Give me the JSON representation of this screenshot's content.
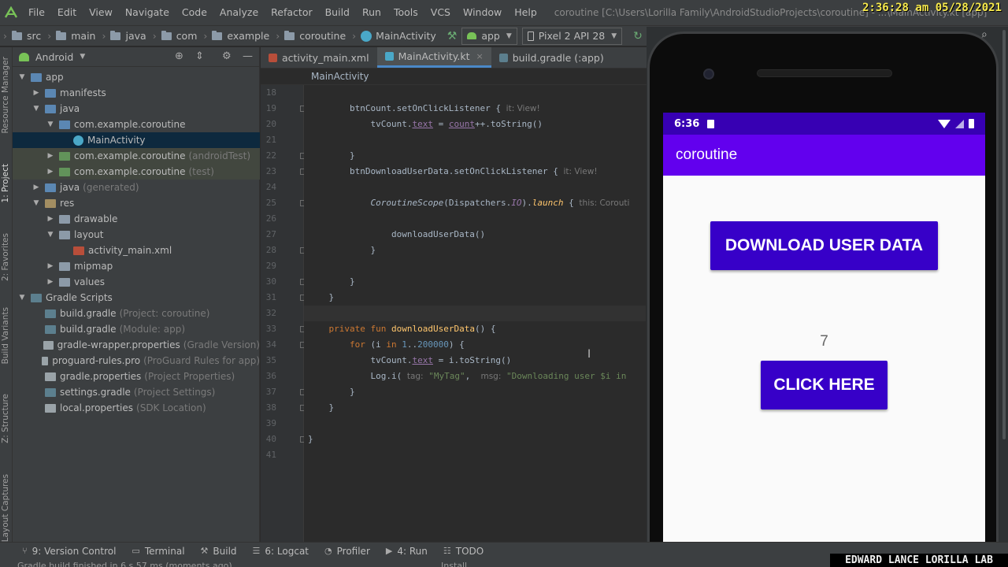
{
  "clock": "2:36:28 am 05/28/2021",
  "menu": [
    "File",
    "Edit",
    "View",
    "Navigate",
    "Code",
    "Analyze",
    "Refactor",
    "Build",
    "Run",
    "Tools",
    "VCS",
    "Window",
    "Help"
  ],
  "window_title": "coroutine [C:\\Users\\Lorilla Family\\AndroidStudioProjects\\coroutine] - ...\\MainActivity.kt [app]",
  "breadcrumb": [
    "src",
    "main",
    "java",
    "com",
    "example",
    "coroutine",
    "MainActivity"
  ],
  "run_config": "app",
  "device": "Pixel 2 API 28",
  "project_view": "Android",
  "left_strip": [
    "Resource Manager",
    "1: Project",
    "2: Favorites",
    "Build Variants",
    "Z: Structure",
    "Layout Captures"
  ],
  "tree": [
    {
      "label": "app",
      "hint": "",
      "depth": 0,
      "arrow": "▼",
      "icon": "i-folder-blue",
      "state": ""
    },
    {
      "label": "manifests",
      "hint": "",
      "depth": 1,
      "arrow": "▶",
      "icon": "i-folder-blue",
      "state": ""
    },
    {
      "label": "java",
      "hint": "",
      "depth": 1,
      "arrow": "▼",
      "icon": "i-folder-blue",
      "state": ""
    },
    {
      "label": "com.example.coroutine",
      "hint": "",
      "depth": 2,
      "arrow": "▼",
      "icon": "i-folder-blue",
      "state": ""
    },
    {
      "label": "MainActivity",
      "hint": "",
      "depth": 3,
      "arrow": "",
      "icon": "i-kt",
      "state": "sel"
    },
    {
      "label": "com.example.coroutine",
      "hint": "(androidTest)",
      "depth": 2,
      "arrow": "▶",
      "icon": "i-folder-green",
      "state": "test"
    },
    {
      "label": "com.example.coroutine",
      "hint": "(test)",
      "depth": 2,
      "arrow": "▶",
      "icon": "i-folder-green",
      "state": "test"
    },
    {
      "label": "java",
      "hint": "(generated)",
      "depth": 1,
      "arrow": "▶",
      "icon": "i-folder-blue",
      "state": ""
    },
    {
      "label": "res",
      "hint": "",
      "depth": 1,
      "arrow": "▼",
      "icon": "i-folder-res",
      "state": ""
    },
    {
      "label": "drawable",
      "hint": "",
      "depth": 2,
      "arrow": "▶",
      "icon": "i-folder",
      "state": ""
    },
    {
      "label": "layout",
      "hint": "",
      "depth": 2,
      "arrow": "▼",
      "icon": "i-folder",
      "state": ""
    },
    {
      "label": "activity_main.xml",
      "hint": "",
      "depth": 3,
      "arrow": "",
      "icon": "i-xml",
      "state": ""
    },
    {
      "label": "mipmap",
      "hint": "",
      "depth": 2,
      "arrow": "▶",
      "icon": "i-folder",
      "state": ""
    },
    {
      "label": "values",
      "hint": "",
      "depth": 2,
      "arrow": "▶",
      "icon": "i-folder",
      "state": ""
    },
    {
      "label": "Gradle Scripts",
      "hint": "",
      "depth": 0,
      "arrow": "▼",
      "icon": "i-gradle",
      "state": ""
    },
    {
      "label": "build.gradle",
      "hint": "(Project: coroutine)",
      "depth": 1,
      "arrow": "",
      "icon": "i-gradle",
      "state": ""
    },
    {
      "label": "build.gradle",
      "hint": "(Module: app)",
      "depth": 1,
      "arrow": "",
      "icon": "i-gradle",
      "state": ""
    },
    {
      "label": "gradle-wrapper.properties",
      "hint": "(Gradle Version)",
      "depth": 1,
      "arrow": "",
      "icon": "i-file",
      "state": ""
    },
    {
      "label": "proguard-rules.pro",
      "hint": "(ProGuard Rules for app)",
      "depth": 1,
      "arrow": "",
      "icon": "i-file",
      "state": ""
    },
    {
      "label": "gradle.properties",
      "hint": "(Project Properties)",
      "depth": 1,
      "arrow": "",
      "icon": "i-file",
      "state": ""
    },
    {
      "label": "settings.gradle",
      "hint": "(Project Settings)",
      "depth": 1,
      "arrow": "",
      "icon": "i-gradle",
      "state": ""
    },
    {
      "label": "local.properties",
      "hint": "(SDK Location)",
      "depth": 1,
      "arrow": "",
      "icon": "i-file",
      "state": ""
    }
  ],
  "tabs": [
    {
      "label": "activity_main.xml",
      "active": false
    },
    {
      "label": "MainActivity.kt",
      "active": true
    },
    {
      "label": "build.gradle (:app)",
      "active": false
    }
  ],
  "editor_breadcrumb": "MainActivity",
  "code_lines": [
    {
      "n": "18",
      "html": ""
    },
    {
      "n": "19",
      "html": "        btnCount.setOnClickListener { <span class='inl2'>it: View!</span>"
    },
    {
      "n": "20",
      "html": "            tvCount.<span class='prop'>text</span> = <span class='prop'>count</span>++.toString()"
    },
    {
      "n": "21",
      "html": ""
    },
    {
      "n": "22",
      "html": "        }"
    },
    {
      "n": "23",
      "html": "        btnDownloadUserData.setOnClickListener { <span class='inl2'>it: View!</span>"
    },
    {
      "n": "24",
      "html": ""
    },
    {
      "n": "25",
      "html": "            <span class='it'>CoroutineScope</span>(Dispatchers.<span class='prop' style='text-decoration:none;font-style:italic'>IO</span>).<span class='itfn'>launch</span> { <span class='inl2'>this: Corouti</span>"
    },
    {
      "n": "26",
      "html": ""
    },
    {
      "n": "27",
      "html": "                downloadUserData()"
    },
    {
      "n": "28",
      "html": "            }"
    },
    {
      "n": "29",
      "html": ""
    },
    {
      "n": "30",
      "html": "        }"
    },
    {
      "n": "31",
      "html": "    }"
    },
    {
      "n": "32",
      "html": ""
    },
    {
      "n": "33",
      "html": "    <span class='kw'>private fun</span> <span class='fn'>downloadUserData</span>() {"
    },
    {
      "n": "34",
      "html": "        <span class='kw'>for</span> (i <span class='kw'>in</span> <span class='num'>1</span>..<span class='num'>200000</span>) {"
    },
    {
      "n": "35",
      "html": "            tvCount.<span class='prop'>text</span> = i.toString()"
    },
    {
      "n": "36",
      "html": "            Log.i( <span class='inl2'>tag:</span> <span class='str'>\"MyTag\"</span>,  <span class='inl2'>msg:</span> <span class='str'>\"Downloading user $i in</span>"
    },
    {
      "n": "37",
      "html": "        }"
    },
    {
      "n": "38",
      "html": "    }"
    },
    {
      "n": "39",
      "html": ""
    },
    {
      "n": "40",
      "html": "}"
    },
    {
      "n": "41",
      "html": ""
    }
  ],
  "tool_windows": [
    {
      "icon": "⑂",
      "label": "9: Version Control"
    },
    {
      "icon": "▭",
      "label": "Terminal"
    },
    {
      "icon": "⚒",
      "label": "Build"
    },
    {
      "icon": "☰",
      "label": "6: Logcat"
    },
    {
      "icon": "◔",
      "label": "Profiler"
    },
    {
      "icon": "▶",
      "label": "4: Run"
    },
    {
      "icon": "☷",
      "label": "TODO"
    }
  ],
  "status_text": "Gradle build finished in 6 s 57 ms (moments ago)",
  "status_right": "Install",
  "phone": {
    "time": "6:36",
    "app_title": "coroutine",
    "download_button": "DOWNLOAD USER DATA",
    "count": "7",
    "click_button": "CLICK HERE"
  },
  "watermark": "EDWARD LANCE LORILLA LAB",
  "colors": {
    "accent": "#4a88c7",
    "app_primary": "#6200ee",
    "button": "#3700c8"
  }
}
